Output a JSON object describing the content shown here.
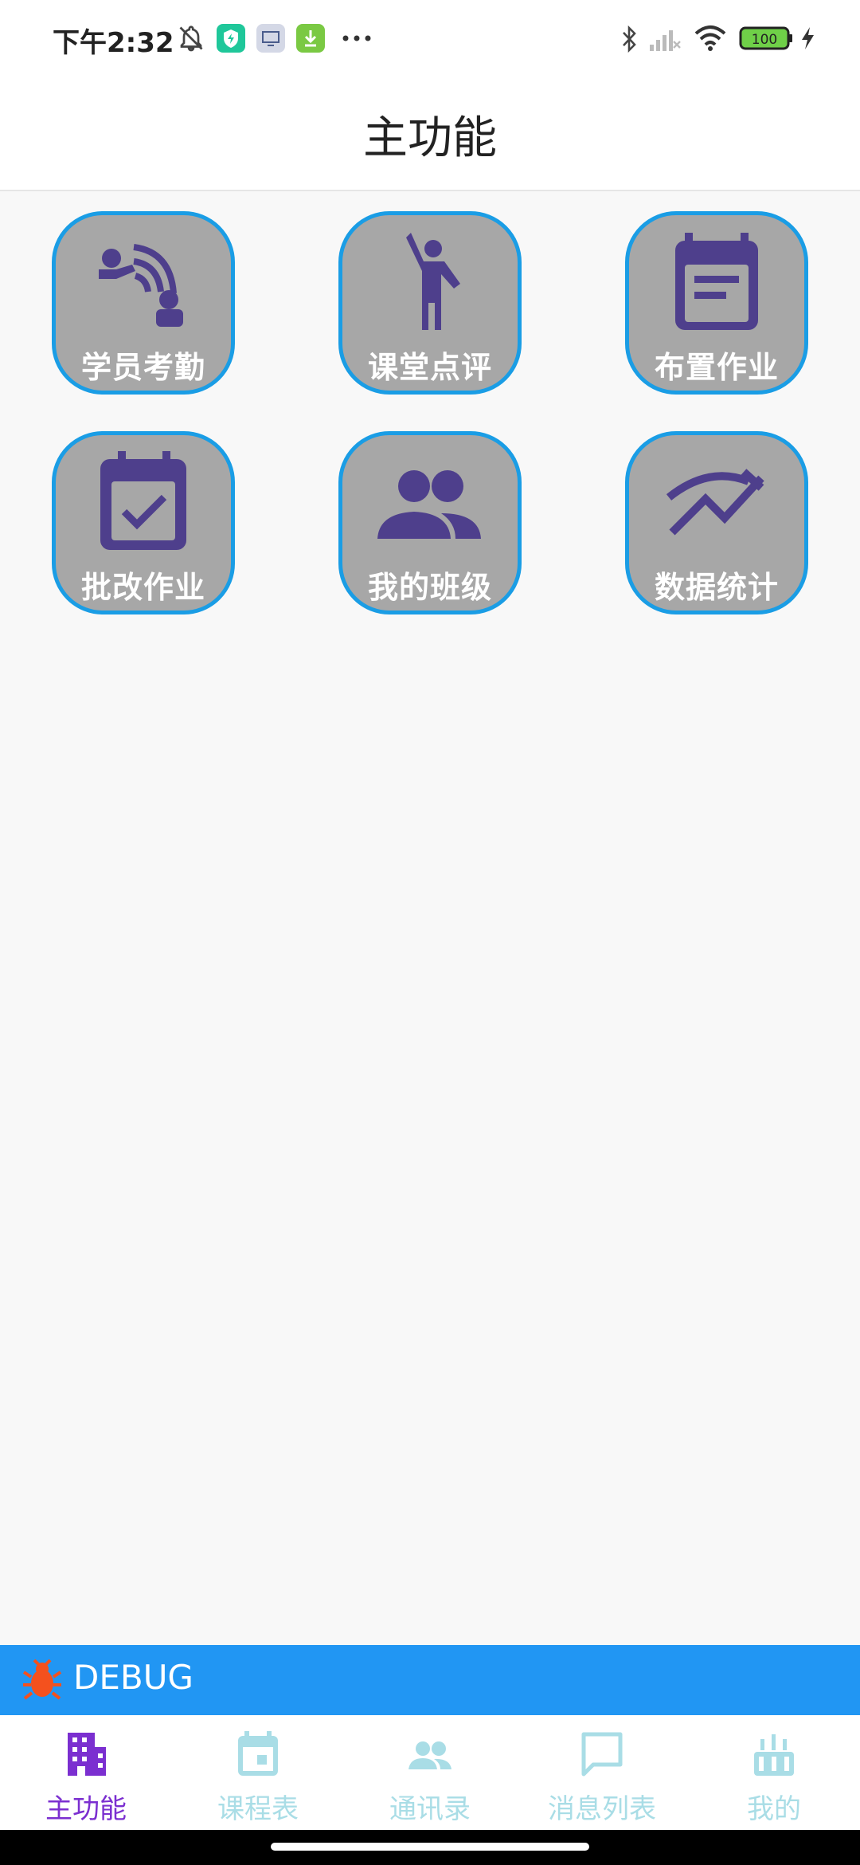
{
  "status_bar": {
    "time": "下午2:32",
    "battery": "100",
    "icons": [
      "mute-icon",
      "shield-app-icon",
      "screen-app-icon",
      "download-app-icon",
      "more-dots-icon",
      "bluetooth-icon",
      "signal-icon",
      "wifi-icon",
      "battery-icon",
      "charging-icon"
    ]
  },
  "header": {
    "title": "主功能"
  },
  "tiles": [
    {
      "label": "学员考勤",
      "icon": "attendance-icon"
    },
    {
      "label": "课堂点评",
      "icon": "classroom-review-icon"
    },
    {
      "label": "布置作业",
      "icon": "assign-homework-icon"
    },
    {
      "label": "批改作业",
      "icon": "grade-homework-icon"
    },
    {
      "label": "我的班级",
      "icon": "my-class-icon"
    },
    {
      "label": "数据统计",
      "icon": "statistics-icon"
    }
  ],
  "debug": {
    "label": "DEBUG",
    "icon": "bug-icon"
  },
  "bottom_nav": {
    "items": [
      {
        "label": "主功能",
        "icon": "building-icon",
        "active": true
      },
      {
        "label": "课程表",
        "icon": "calendar-icon",
        "active": false
      },
      {
        "label": "通讯录",
        "icon": "contacts-icon",
        "active": false
      },
      {
        "label": "消息列表",
        "icon": "message-icon",
        "active": false
      },
      {
        "label": "我的",
        "icon": "profile-icon",
        "active": false
      }
    ]
  },
  "colors": {
    "tile_bg": "#a7a7a7",
    "tile_border": "#1a9de5",
    "tile_icon": "#4e3f8c",
    "debug_bar": "#2196f3",
    "debug_icon": "#f4511e",
    "nav_active": "#7b2fd0",
    "nav_inactive": "#a9dde6"
  }
}
